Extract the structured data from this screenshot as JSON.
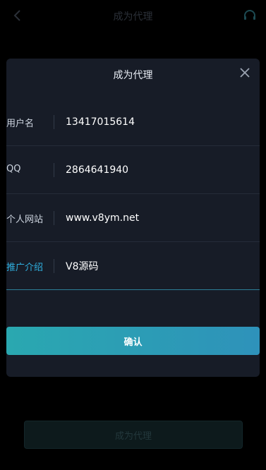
{
  "header": {
    "title": "成为代理",
    "back_icon": "chevron-left-icon",
    "support_icon": "headset-icon"
  },
  "modal": {
    "title": "成为代理",
    "close_icon": "close-icon",
    "fields": [
      {
        "label": "用户名",
        "value": "13417015614"
      },
      {
        "label": "QQ",
        "value": "2864641940"
      },
      {
        "label": "个人网站",
        "value": "www.v8ym.net"
      },
      {
        "label": "推广介绍",
        "value": "V8源码"
      }
    ],
    "confirm_label": "确认"
  },
  "footer": {
    "button_label": "成为代理"
  },
  "colors": {
    "accent": "#2fb0e0",
    "confirm_gradient_start": "#2aa8b0",
    "confirm_gradient_end": "#2e92ba",
    "modal_bg": "#171c27"
  }
}
